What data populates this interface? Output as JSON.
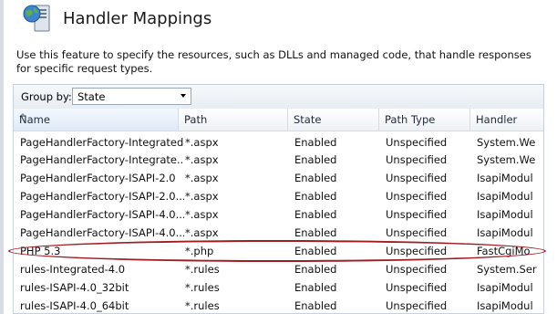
{
  "header": {
    "title": "Handler Mappings",
    "icon": "globe-server-icon"
  },
  "description": "Use this feature to specify the resources, such as DLLs and managed code, that handle responses for specific request types.",
  "groupby": {
    "label": "Group by:",
    "value": "State"
  },
  "columns": [
    "Name",
    "Path",
    "State",
    "Path Type",
    "Handler"
  ],
  "sorted_column": "Name",
  "rows": [
    [
      "PageHandlerFactory-Integrated",
      "*.aspx",
      "Enabled",
      "Unspecified",
      "System.We"
    ],
    [
      "PageHandlerFactory-Integrate...",
      "*.aspx",
      "Enabled",
      "Unspecified",
      "System.We"
    ],
    [
      "PageHandlerFactory-ISAPI-2.0",
      "*.aspx",
      "Enabled",
      "Unspecified",
      "IsapiModul"
    ],
    [
      "PageHandlerFactory-ISAPI-2.0...",
      "*.aspx",
      "Enabled",
      "Unspecified",
      "IsapiModul"
    ],
    [
      "PageHandlerFactory-ISAPI-4.0...",
      "*.aspx",
      "Enabled",
      "Unspecified",
      "IsapiModul"
    ],
    [
      "PageHandlerFactory-ISAPI-4.0...",
      "*.aspx",
      "Enabled",
      "Unspecified",
      "IsapiModul"
    ],
    [
      "PHP 5.3",
      "*.php",
      "Enabled",
      "Unspecified",
      "FastCgiMo"
    ],
    [
      "rules-Integrated-4.0",
      "*.rules",
      "Enabled",
      "Unspecified",
      "System.Ser"
    ],
    [
      "rules-ISAPI-4.0_32bit",
      "*.rules",
      "Enabled",
      "Unspecified",
      "IsapiModul"
    ],
    [
      "rules-ISAPI-4.0_64bit",
      "*.rules",
      "Enabled",
      "Unspecified",
      "IsapiModul"
    ]
  ],
  "highlighted_row": "PHP 5.3",
  "colors": {
    "highlight_ellipse": "#a01c22",
    "title_text": "#1a1a1a"
  }
}
